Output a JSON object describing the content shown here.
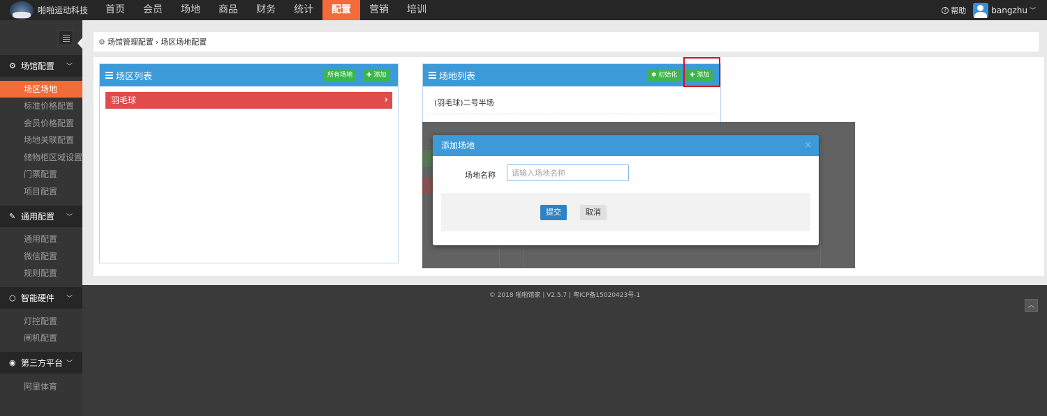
{
  "header": {
    "brand_name": "啪啪运动科技",
    "nav": [
      "首页",
      "会员",
      "场地",
      "商品",
      "财务",
      "统计",
      "配置",
      "营销",
      "培训"
    ],
    "active_nav": "配置",
    "help": "帮助",
    "username": "bangzhu"
  },
  "sidebar": {
    "groups": [
      {
        "label": "场馆配置",
        "icon": "gears-icon",
        "items": [
          "场区场地",
          "标准价格配置",
          "会员价格配置",
          "场地关联配置",
          "储物柜区域设置",
          "门票配置",
          "项目配置"
        ]
      },
      {
        "label": "通用配置",
        "icon": "wrench-icon",
        "items": [
          "通用配置",
          "微信配置",
          "规则配置"
        ]
      },
      {
        "label": "智能硬件",
        "icon": "circle-icon",
        "items": [
          "灯控配置",
          "闸机配置"
        ]
      },
      {
        "label": "第三方平台",
        "icon": "eye-icon",
        "items": [
          "阿里体育"
        ]
      }
    ],
    "active_item": "场区场地"
  },
  "breadcrumb": {
    "parent": "场馆管理配置",
    "separator": "›",
    "current": "场区场地配置"
  },
  "area_panel": {
    "title": "场区列表",
    "btn_all": "所有场地",
    "btn_add": "添加",
    "rows": [
      {
        "name": "羽毛球",
        "arrow": "›"
      }
    ]
  },
  "venue_panel": {
    "title": "场地列表",
    "btn_init": "初始化",
    "btn_add": "添加",
    "rows": [
      "(羽毛球)二号半场"
    ]
  },
  "modal": {
    "title": "添加场地",
    "close": "×",
    "field_label": "场地名称",
    "field_placeholder": "请输入场地名称",
    "field_value": "",
    "submit": "提交",
    "cancel": "取消"
  },
  "footer": {
    "text": "© 2018 啪啪馆家 | V2.5.7 | 粤ICP备15020423号-1"
  },
  "colors": {
    "accent": "#f26b38",
    "panel_header": "#3d9ad9",
    "green": "#3cb54a",
    "red_row": "#e04b4b",
    "submit": "#2f82c4"
  }
}
